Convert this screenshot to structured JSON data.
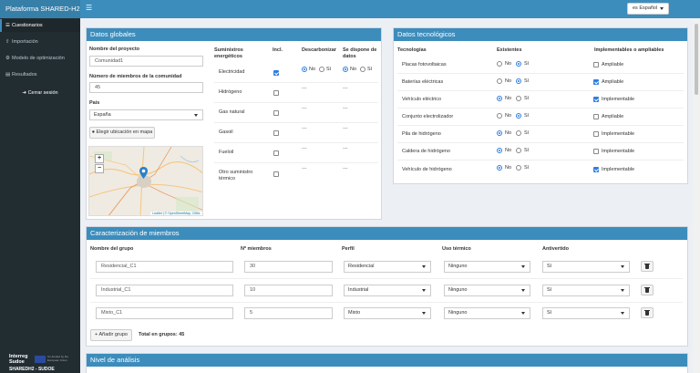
{
  "app": {
    "title": "Plataforma SHARED-H2",
    "language": "es Español"
  },
  "sidebar": {
    "items": [
      {
        "label": "Cuestionarios",
        "icon": "list-icon"
      },
      {
        "label": "Importación",
        "icon": "upload-icon"
      },
      {
        "label": "Modelo de optimización",
        "icon": "gear-icon"
      },
      {
        "label": "Resultados",
        "icon": "chart-icon"
      }
    ],
    "logout": "Cerrar sesión",
    "logo": {
      "interreg": "Interreg",
      "sudoe": "Sudoe",
      "project": "SHAREDH2 - SUDOE",
      "eu_text": "Co-funded by the European Union"
    }
  },
  "datos_globales": {
    "title": "Datos globales",
    "project_label": "Nombre del proyecto",
    "project_value": "Comunidad1",
    "members_label": "Número de miembros de la comunidad",
    "members_value": "45",
    "country_label": "País",
    "country_value": "España",
    "map_button": "Elegir ubicación en mapa",
    "map_attribution": "Leaflet | © OpenStreetMap, ODbL",
    "supplies": {
      "headers": {
        "name": "Suministros energéticos",
        "incl": "Incl.",
        "decarb": "Descarbonizar",
        "avail": "Se dispone de datos"
      },
      "no": "No",
      "si": "Sí",
      "rows": [
        {
          "name": "Electricidad",
          "included": true,
          "decarb": "No",
          "avail": "No"
        },
        {
          "name": "Hidrógeno",
          "included": false,
          "decarb": "---",
          "avail": "---"
        },
        {
          "name": "Gas natural",
          "included": false,
          "decarb": "---",
          "avail": "---"
        },
        {
          "name": "Gasoil",
          "included": false,
          "decarb": "---",
          "avail": "---"
        },
        {
          "name": "Fueloil",
          "included": false,
          "decarb": "---",
          "avail": "---"
        },
        {
          "name": "Otro suministro térmico",
          "included": false,
          "decarb": "---",
          "avail": "---"
        }
      ]
    }
  },
  "datos_tecnologicos": {
    "title": "Datos tecnológicos",
    "headers": {
      "tech": "Tecnologías",
      "exist": "Existentes",
      "impl": "Implementables o ampliables"
    },
    "no": "No",
    "si": "Sí",
    "rows": [
      {
        "name": "Placas fotovoltaicas",
        "existing": "Sí",
        "impl_checked": false,
        "impl_label": "Ampliable"
      },
      {
        "name": "Baterías eléctricas",
        "existing": "Sí",
        "impl_checked": true,
        "impl_label": "Ampliable"
      },
      {
        "name": "Vehículo eléctrico",
        "existing": "No",
        "impl_checked": true,
        "impl_label": "Implementable"
      },
      {
        "name": "Conjunto electrolizador",
        "existing": "Sí",
        "impl_checked": false,
        "impl_label": "Ampliable"
      },
      {
        "name": "Pila de hidrógeno",
        "existing": "No",
        "impl_checked": false,
        "impl_label": "Implementable"
      },
      {
        "name": "Caldera de hidrógeno",
        "existing": "No",
        "impl_checked": false,
        "impl_label": "Implementable"
      },
      {
        "name": "Vehículo de hidrógeno",
        "existing": "No",
        "impl_checked": true,
        "impl_label": "Implementable"
      }
    ]
  },
  "caracterizacion": {
    "title": "Caracterización de miembros",
    "headers": {
      "group": "Nombre del grupo",
      "members": "Nº miembros",
      "profile": "Perfil",
      "thermal": "Uso térmico",
      "avert": "Antivertido"
    },
    "rows": [
      {
        "group": "Residencial_C1",
        "members": "30",
        "profile": "Residencial",
        "thermal": "Ninguno",
        "avert": "Sí"
      },
      {
        "group": "Industrial_C1",
        "members": "10",
        "profile": "Industrial",
        "thermal": "Ninguno",
        "avert": "Sí"
      },
      {
        "group": "Mixto_C1",
        "members": "5",
        "profile": "Mixto",
        "thermal": "Ninguno",
        "avert": "Sí"
      }
    ],
    "add_button": "Añadir grupo",
    "total": "Total en grupos: 45"
  },
  "nivel": {
    "title": "Nivel de análisis"
  },
  "colors": {
    "header": "#3c8dbc",
    "sidebar": "#222d32",
    "accent": "#2e7de0"
  }
}
